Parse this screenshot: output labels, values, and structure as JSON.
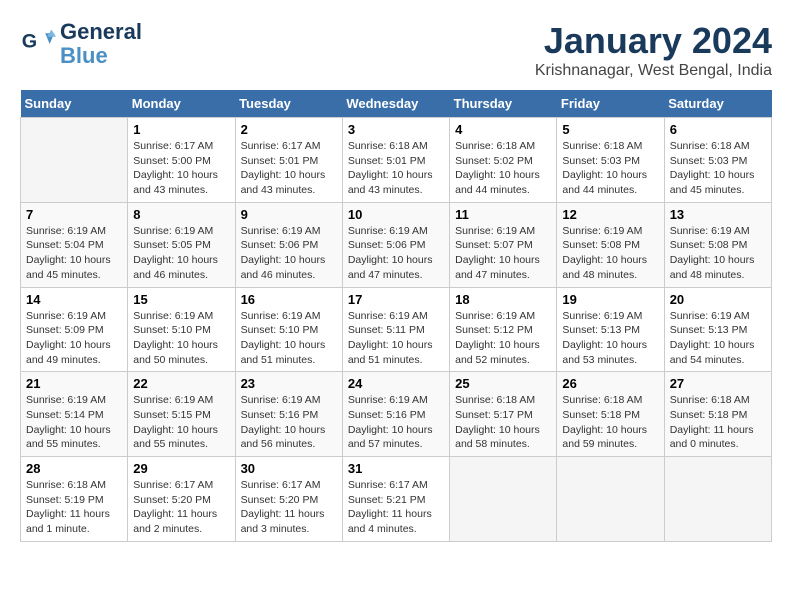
{
  "logo": {
    "line1": "General",
    "line2": "Blue"
  },
  "title": "January 2024",
  "subtitle": "Krishnanagar, West Bengal, India",
  "weekdays": [
    "Sunday",
    "Monday",
    "Tuesday",
    "Wednesday",
    "Thursday",
    "Friday",
    "Saturday"
  ],
  "weeks": [
    [
      {
        "day": "",
        "text": ""
      },
      {
        "day": "1",
        "text": "Sunrise: 6:17 AM\nSunset: 5:00 PM\nDaylight: 10 hours and 43 minutes."
      },
      {
        "day": "2",
        "text": "Sunrise: 6:17 AM\nSunset: 5:01 PM\nDaylight: 10 hours and 43 minutes."
      },
      {
        "day": "3",
        "text": "Sunrise: 6:18 AM\nSunset: 5:01 PM\nDaylight: 10 hours and 43 minutes."
      },
      {
        "day": "4",
        "text": "Sunrise: 6:18 AM\nSunset: 5:02 PM\nDaylight: 10 hours and 44 minutes."
      },
      {
        "day": "5",
        "text": "Sunrise: 6:18 AM\nSunset: 5:03 PM\nDaylight: 10 hours and 44 minutes."
      },
      {
        "day": "6",
        "text": "Sunrise: 6:18 AM\nSunset: 5:03 PM\nDaylight: 10 hours and 45 minutes."
      }
    ],
    [
      {
        "day": "7",
        "text": "Sunrise: 6:19 AM\nSunset: 5:04 PM\nDaylight: 10 hours and 45 minutes."
      },
      {
        "day": "8",
        "text": "Sunrise: 6:19 AM\nSunset: 5:05 PM\nDaylight: 10 hours and 46 minutes."
      },
      {
        "day": "9",
        "text": "Sunrise: 6:19 AM\nSunset: 5:06 PM\nDaylight: 10 hours and 46 minutes."
      },
      {
        "day": "10",
        "text": "Sunrise: 6:19 AM\nSunset: 5:06 PM\nDaylight: 10 hours and 47 minutes."
      },
      {
        "day": "11",
        "text": "Sunrise: 6:19 AM\nSunset: 5:07 PM\nDaylight: 10 hours and 47 minutes."
      },
      {
        "day": "12",
        "text": "Sunrise: 6:19 AM\nSunset: 5:08 PM\nDaylight: 10 hours and 48 minutes."
      },
      {
        "day": "13",
        "text": "Sunrise: 6:19 AM\nSunset: 5:08 PM\nDaylight: 10 hours and 48 minutes."
      }
    ],
    [
      {
        "day": "14",
        "text": "Sunrise: 6:19 AM\nSunset: 5:09 PM\nDaylight: 10 hours and 49 minutes."
      },
      {
        "day": "15",
        "text": "Sunrise: 6:19 AM\nSunset: 5:10 PM\nDaylight: 10 hours and 50 minutes."
      },
      {
        "day": "16",
        "text": "Sunrise: 6:19 AM\nSunset: 5:10 PM\nDaylight: 10 hours and 51 minutes."
      },
      {
        "day": "17",
        "text": "Sunrise: 6:19 AM\nSunset: 5:11 PM\nDaylight: 10 hours and 51 minutes."
      },
      {
        "day": "18",
        "text": "Sunrise: 6:19 AM\nSunset: 5:12 PM\nDaylight: 10 hours and 52 minutes."
      },
      {
        "day": "19",
        "text": "Sunrise: 6:19 AM\nSunset: 5:13 PM\nDaylight: 10 hours and 53 minutes."
      },
      {
        "day": "20",
        "text": "Sunrise: 6:19 AM\nSunset: 5:13 PM\nDaylight: 10 hours and 54 minutes."
      }
    ],
    [
      {
        "day": "21",
        "text": "Sunrise: 6:19 AM\nSunset: 5:14 PM\nDaylight: 10 hours and 55 minutes."
      },
      {
        "day": "22",
        "text": "Sunrise: 6:19 AM\nSunset: 5:15 PM\nDaylight: 10 hours and 55 minutes."
      },
      {
        "day": "23",
        "text": "Sunrise: 6:19 AM\nSunset: 5:16 PM\nDaylight: 10 hours and 56 minutes."
      },
      {
        "day": "24",
        "text": "Sunrise: 6:19 AM\nSunset: 5:16 PM\nDaylight: 10 hours and 57 minutes."
      },
      {
        "day": "25",
        "text": "Sunrise: 6:18 AM\nSunset: 5:17 PM\nDaylight: 10 hours and 58 minutes."
      },
      {
        "day": "26",
        "text": "Sunrise: 6:18 AM\nSunset: 5:18 PM\nDaylight: 10 hours and 59 minutes."
      },
      {
        "day": "27",
        "text": "Sunrise: 6:18 AM\nSunset: 5:18 PM\nDaylight: 11 hours and 0 minutes."
      }
    ],
    [
      {
        "day": "28",
        "text": "Sunrise: 6:18 AM\nSunset: 5:19 PM\nDaylight: 11 hours and 1 minute."
      },
      {
        "day": "29",
        "text": "Sunrise: 6:17 AM\nSunset: 5:20 PM\nDaylight: 11 hours and 2 minutes."
      },
      {
        "day": "30",
        "text": "Sunrise: 6:17 AM\nSunset: 5:20 PM\nDaylight: 11 hours and 3 minutes."
      },
      {
        "day": "31",
        "text": "Sunrise: 6:17 AM\nSunset: 5:21 PM\nDaylight: 11 hours and 4 minutes."
      },
      {
        "day": "",
        "text": ""
      },
      {
        "day": "",
        "text": ""
      },
      {
        "day": "",
        "text": ""
      }
    ]
  ]
}
